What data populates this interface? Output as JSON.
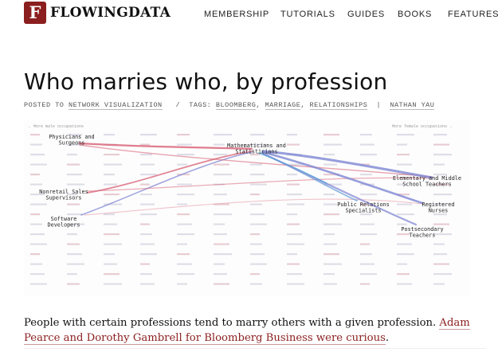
{
  "site": {
    "logo_letter": "F",
    "name": "FLOWINGDATA",
    "brand_color": "#8b1e1e"
  },
  "nav": {
    "items": [
      "MEMBERSHIP",
      "TUTORIALS",
      "GUIDES",
      "BOOKS",
      "FEATURES"
    ]
  },
  "post": {
    "title": "Who marries who, by profession",
    "meta": {
      "posted_to_label": "POSTED TO",
      "category": "NETWORK VISUALIZATION",
      "tags_label": "TAGS:",
      "tags": [
        "BLOOMBERG",
        "MARRIAGE",
        "RELATIONSHIPS"
      ],
      "author": "NATHAN YAU"
    },
    "intro_text": "People with certain professions tend to marry others with a given profession.",
    "intro_link": "Adam Pearce and Dorothy Gambrell for Bloomberg Business were curious",
    "intro_end": "."
  },
  "viz": {
    "left_header": "← More male occupations",
    "right_header": "More female occupations →",
    "male_color": "#d9667a",
    "female_color": "#8a8fd6",
    "node_labels": {
      "physicians": "Physicians and Surgeons",
      "nonretail": "Nonretail Sales Supervisors",
      "software": "Software Developers",
      "math": "Mathematicians and Statisticians",
      "elementary": "Elementary and Middle School Teachers",
      "public_relations": "Public Relations Specialists",
      "nurses": "Registered Nurses",
      "postsecondary": "Postsecondary Teachers"
    }
  }
}
